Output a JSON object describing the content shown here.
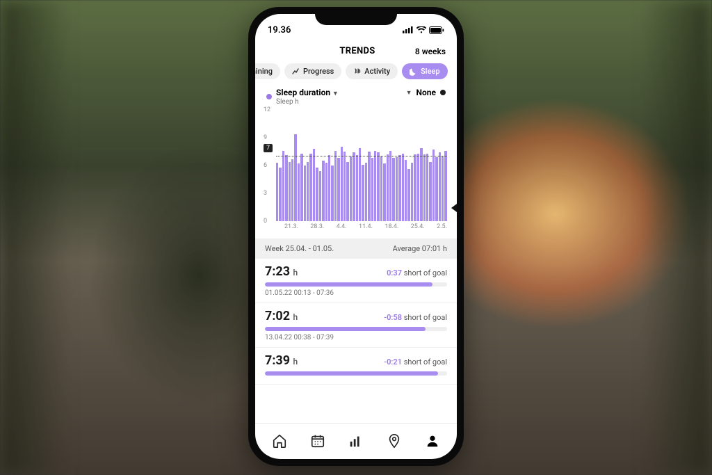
{
  "status": {
    "time": "19.36"
  },
  "header": {
    "title": "TRENDS",
    "range": "8 weeks"
  },
  "tabs": {
    "training": "aining",
    "progress": "Progress",
    "activity": "Activity",
    "sleep": "Sleep"
  },
  "metric": {
    "primary_label": "Sleep duration",
    "primary_sub": "Sleep h",
    "secondary_label": "None"
  },
  "summary": {
    "week": "Week 25.04. - 01.05.",
    "average": "Average 07:01 h"
  },
  "entries": [
    {
      "duration": "7:23",
      "unit": "h",
      "delta": "0:37",
      "note": "short of goal",
      "pct": 92,
      "timestamp": "01.05.22 00:13 - 07:36"
    },
    {
      "duration": "7:02",
      "unit": "h",
      "delta": "-0:58",
      "note": "short of goal",
      "pct": 88,
      "timestamp": "13.04.22 00:38 - 07:39"
    },
    {
      "duration": "7:39",
      "unit": "h",
      "delta": "-0:21",
      "note": "short of goal",
      "pct": 95,
      "timestamp": ""
    }
  ],
  "chart_data": {
    "type": "bar",
    "title": "Sleep duration",
    "xlabel": "",
    "ylabel": "Sleep h",
    "ylim": [
      0,
      12
    ],
    "yticks": [
      0,
      3,
      6,
      9,
      12
    ],
    "target": 7,
    "categories": [
      "21.3.",
      "28.3.",
      "4.4.",
      "11.4.",
      "18.4.",
      "25.4.",
      "2.5."
    ],
    "values": [
      6.3,
      5.8,
      7.6,
      7.1,
      6.4,
      6.7,
      9.4,
      6.2,
      7.3,
      6.0,
      6.4,
      7.3,
      7.8,
      5.8,
      5.4,
      6.5,
      6.3,
      7.1,
      6.0,
      7.6,
      6.8,
      8.0,
      7.5,
      6.4,
      7.0,
      7.4,
      7.1,
      7.9,
      6.1,
      6.3,
      7.5,
      6.8,
      7.6,
      7.4,
      7.0,
      6.2,
      7.2,
      7.6,
      6.8,
      6.9,
      7.1,
      7.3,
      6.6,
      5.6,
      6.3,
      7.2,
      7.3,
      7.9,
      7.2,
      7.3,
      6.4,
      7.7,
      6.9,
      7.4,
      7.0,
      7.6
    ]
  }
}
